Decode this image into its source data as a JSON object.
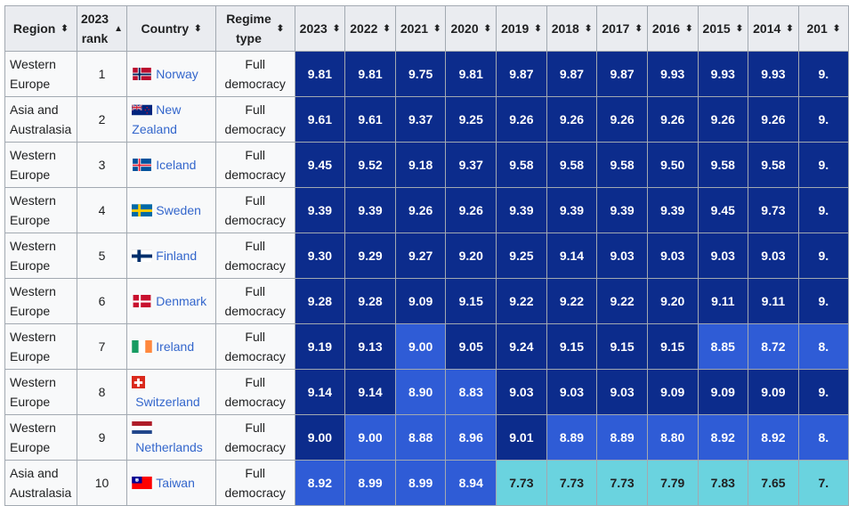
{
  "table": {
    "headers": {
      "region": "Region",
      "rank_line1": "2023",
      "rank_line2": "rank",
      "country": "Country",
      "regime_line1": "Regime",
      "regime_line2": "type",
      "sort_icon": "⬍",
      "sorted_asc_icon": "▲",
      "years": [
        "2023",
        "2022",
        "2021",
        "2020",
        "2019",
        "2018",
        "2017",
        "2016",
        "2015",
        "2014",
        "201"
      ]
    },
    "sort": {
      "column": "2023 rank",
      "direction": "ascending"
    },
    "score_colors": {
      "dark": "#0c2c8c",
      "mid": "#2f5cd6",
      "cyan": "#6ad3df"
    },
    "rows": [
      {
        "region": "Western Europe",
        "rank": "1",
        "country": "Norway",
        "flag": "norway-flag-icon",
        "regime": "Full democracy",
        "scores": [
          "9.81",
          "9.81",
          "9.75",
          "9.81",
          "9.87",
          "9.87",
          "9.87",
          "9.93",
          "9.93",
          "9.93",
          "9."
        ],
        "tiers": [
          "dark",
          "dark",
          "dark",
          "dark",
          "dark",
          "dark",
          "dark",
          "dark",
          "dark",
          "dark",
          "dark"
        ]
      },
      {
        "region": "Asia and Australasia",
        "rank": "2",
        "country": "New Zealand",
        "flag": "new-zealand-flag-icon",
        "regime": "Full democracy",
        "scores": [
          "9.61",
          "9.61",
          "9.37",
          "9.25",
          "9.26",
          "9.26",
          "9.26",
          "9.26",
          "9.26",
          "9.26",
          "9."
        ],
        "tiers": [
          "dark",
          "dark",
          "dark",
          "dark",
          "dark",
          "dark",
          "dark",
          "dark",
          "dark",
          "dark",
          "dark"
        ]
      },
      {
        "region": "Western Europe",
        "rank": "3",
        "country": "Iceland",
        "flag": "iceland-flag-icon",
        "regime": "Full democracy",
        "scores": [
          "9.45",
          "9.52",
          "9.18",
          "9.37",
          "9.58",
          "9.58",
          "9.58",
          "9.50",
          "9.58",
          "9.58",
          "9."
        ],
        "tiers": [
          "dark",
          "dark",
          "dark",
          "dark",
          "dark",
          "dark",
          "dark",
          "dark",
          "dark",
          "dark",
          "dark"
        ]
      },
      {
        "region": "Western Europe",
        "rank": "4",
        "country": "Sweden",
        "flag": "sweden-flag-icon",
        "regime": "Full democracy",
        "scores": [
          "9.39",
          "9.39",
          "9.26",
          "9.26",
          "9.39",
          "9.39",
          "9.39",
          "9.39",
          "9.45",
          "9.73",
          "9."
        ],
        "tiers": [
          "dark",
          "dark",
          "dark",
          "dark",
          "dark",
          "dark",
          "dark",
          "dark",
          "dark",
          "dark",
          "dark"
        ]
      },
      {
        "region": "Western Europe",
        "rank": "5",
        "country": "Finland",
        "flag": "finland-flag-icon",
        "regime": "Full democracy",
        "scores": [
          "9.30",
          "9.29",
          "9.27",
          "9.20",
          "9.25",
          "9.14",
          "9.03",
          "9.03",
          "9.03",
          "9.03",
          "9."
        ],
        "tiers": [
          "dark",
          "dark",
          "dark",
          "dark",
          "dark",
          "dark",
          "dark",
          "dark",
          "dark",
          "dark",
          "dark"
        ]
      },
      {
        "region": "Western Europe",
        "rank": "6",
        "country": "Denmark",
        "flag": "denmark-flag-icon",
        "regime": "Full democracy",
        "scores": [
          "9.28",
          "9.28",
          "9.09",
          "9.15",
          "9.22",
          "9.22",
          "9.22",
          "9.20",
          "9.11",
          "9.11",
          "9."
        ],
        "tiers": [
          "dark",
          "dark",
          "dark",
          "dark",
          "dark",
          "dark",
          "dark",
          "dark",
          "dark",
          "dark",
          "dark"
        ]
      },
      {
        "region": "Western Europe",
        "rank": "7",
        "country": "Ireland",
        "flag": "ireland-flag-icon",
        "regime": "Full democracy",
        "scores": [
          "9.19",
          "9.13",
          "9.00",
          "9.05",
          "9.24",
          "9.15",
          "9.15",
          "9.15",
          "8.85",
          "8.72",
          "8."
        ],
        "tiers": [
          "dark",
          "dark",
          "mid",
          "dark",
          "dark",
          "dark",
          "dark",
          "dark",
          "mid",
          "mid",
          "mid"
        ]
      },
      {
        "region": "Western Europe",
        "rank": "8",
        "country": "Switzerland",
        "flag": "switzerland-flag-icon",
        "regime": "Full democracy",
        "scores": [
          "9.14",
          "9.14",
          "8.90",
          "8.83",
          "9.03",
          "9.03",
          "9.03",
          "9.09",
          "9.09",
          "9.09",
          "9."
        ],
        "tiers": [
          "dark",
          "dark",
          "mid",
          "mid",
          "dark",
          "dark",
          "dark",
          "dark",
          "dark",
          "dark",
          "dark"
        ]
      },
      {
        "region": "Western Europe",
        "rank": "9",
        "country": "Netherlands",
        "flag": "netherlands-flag-icon",
        "regime": "Full democracy",
        "scores": [
          "9.00",
          "9.00",
          "8.88",
          "8.96",
          "9.01",
          "8.89",
          "8.89",
          "8.80",
          "8.92",
          "8.92",
          "8."
        ],
        "tiers": [
          "dark",
          "mid",
          "mid",
          "mid",
          "dark",
          "mid",
          "mid",
          "mid",
          "mid",
          "mid",
          "mid"
        ]
      },
      {
        "region": "Asia and Australasia",
        "rank": "10",
        "country": "Taiwan",
        "flag": "taiwan-flag-icon",
        "regime": "Full democracy",
        "scores": [
          "8.92",
          "8.99",
          "8.99",
          "8.94",
          "7.73",
          "7.73",
          "7.73",
          "7.79",
          "7.83",
          "7.65",
          "7."
        ],
        "tiers": [
          "mid",
          "mid",
          "mid",
          "mid",
          "cyan",
          "cyan",
          "cyan",
          "cyan",
          "cyan",
          "cyan",
          "cyan"
        ]
      }
    ]
  }
}
